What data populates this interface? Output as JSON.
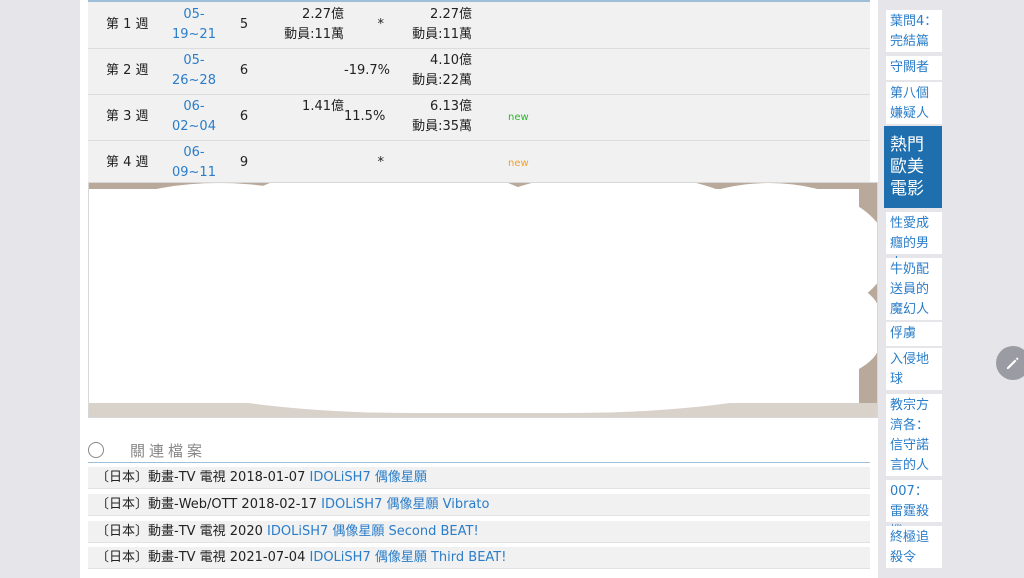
{
  "box_office": {
    "rows": [
      {
        "week": "第 1 週",
        "date": "05-\n19~21",
        "count": "5",
        "amount": "2.27億\n動員:11萬",
        "change": "*",
        "total": "2.27億\n動員:11萬",
        "tag": ""
      },
      {
        "week": "第 2 週",
        "date": "05-\n26~28",
        "count": "6",
        "amount": "",
        "change": "-19.7%",
        "total": "4.10億\n動員:22萬",
        "tag": ""
      },
      {
        "week": "第 3 週",
        "date": "06-\n02~04",
        "count": "6",
        "amount": "1.41億",
        "change": "11.5%",
        "total": "6.13億\n動員:35萬",
        "tag": "new"
      },
      {
        "week": "第 4 週",
        "date": "06-\n09~11",
        "count": "9",
        "amount": "",
        "change": "*",
        "total": "",
        "tag": "new"
      }
    ]
  },
  "related": {
    "title": "關連檔案",
    "items": [
      {
        "prefix": "〔日本〕動畫-TV 電視 2018-01-07 ",
        "link": "IDOLiSH7 偶像星願"
      },
      {
        "prefix": "〔日本〕動畫-Web/OTT 2018-02-17 ",
        "link": "IDOLiSH7 偶像星願 Vibrato"
      },
      {
        "prefix": "〔日本〕動畫-TV 電視 2020 ",
        "link": "IDOLiSH7 偶像星願 Second BEAT!"
      },
      {
        "prefix": "〔日本〕動畫-TV 電視 2021-07-04 ",
        "link": "IDOLiSH7 偶像星願 Third BEAT!"
      }
    ]
  },
  "sidebar": {
    "items_top": [
      "葉問4：完結篇",
      "守闕者",
      "第八個嫌疑人"
    ],
    "active_section": "熱門歐美電影",
    "items_bottom": [
      "性愛成癮的男人",
      "牛奶配送員的魔幻人生",
      "俘虜",
      "入侵地球",
      "教宗方濟各：信守諾言的人",
      "007：雷霆殺機",
      "終極追殺令"
    ]
  },
  "colors": {
    "accent": "#1f6fae",
    "link": "#2a7dc9",
    "new_green": "#2cb52c",
    "new_orange": "#f0a030"
  }
}
